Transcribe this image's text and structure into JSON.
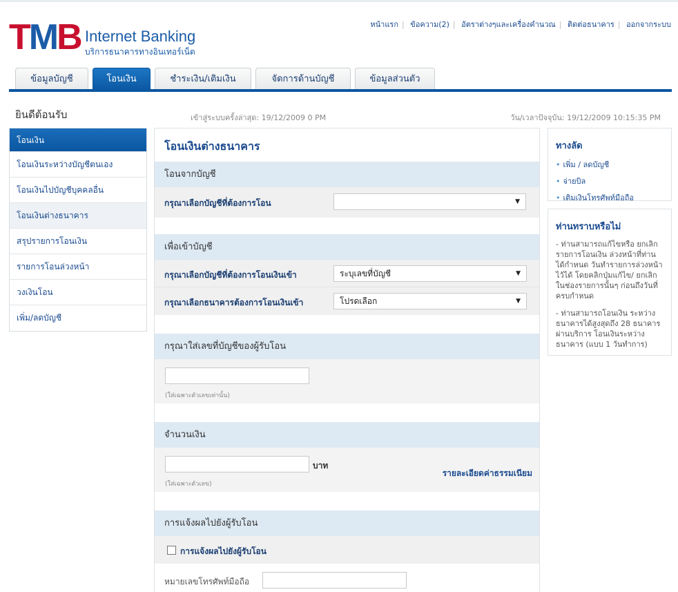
{
  "brand": {
    "logo_text": "TMB",
    "product": "Internet Banking",
    "subtitle": "บริการธนาคารทางอินเทอร์เน็ต"
  },
  "top_links": [
    "หน้าแรก",
    "ข้อความ(2)",
    "อัตราต่างๆและเครื่องคำนวณ",
    "ติดต่อธนาคาร",
    "ออกจากระบบ"
  ],
  "tabs": [
    "ข้อมูลบัญชี",
    "โอนเงิน",
    "ชำระเงิน/เติมเงิน",
    "จัดการด้านบัญชี",
    "ข้อมูลส่วนตัว"
  ],
  "active_tab": "โอนเงิน",
  "welcome": "ยินดีต้อนรับ",
  "last_login": "เข้าสู่ระบบครั้งล่าสุด: 19/12/2009 0        PM",
  "current_time": "วัน/เวลาปัจจุบัน: 19/12/2009 10:15:35 PM",
  "left_menu": {
    "header": "โอนเงิน",
    "items": [
      "โอนเงินระหว่างบัญชีตนเอง",
      "โอนเงินไปบัญชีบุคคลอื่น",
      "โอนเงินต่างธนาคาร",
      "สรุปรายการโอนเงิน",
      "รายการโอนล่วงหน้า",
      "วงเงินโอน",
      "เพิ่ม/ลดบัญชี"
    ],
    "selected": "โอนเงินต่างธนาคาร"
  },
  "main": {
    "title": "โอนเงินต่างธนาคาร",
    "from_section": "โอนจากบัญชี",
    "from_label": "กรุณาเลือกบัญชีที่ต้องการโอน",
    "from_value": "",
    "to_section": "เพื่อเข้าบัญชี",
    "to_account_label": "กรุณาเลือกบัญชีที่ต้องการโอนเงินเข้า",
    "to_account_value": "ระบุเลขที่บัญชี",
    "to_bank_label": "กรุณาเลือกธนาคารต้องการโอนเงินเข้า",
    "to_bank_value": "โปรดเลือก",
    "recipient_section": "กรุณาใส่เลขที่บัญชีของผู้รับโอน",
    "recipient_hint": "(ใส่เฉพาะตัวเลขเท่านั้น)",
    "amount_section": "จำนวนเงิน",
    "amount_unit": "บาท",
    "amount_hint": "(ใส่เฉพาะตัวเลข)",
    "fee_link": "รายละเอียดค่าธรรมเนียม",
    "notify_section": "การแจ้งผลไปยังผู้รับโอน",
    "notify_checkbox": "การแจ้งผลไปยังผู้รับโอน",
    "notify_checked": false,
    "mobile_label": "หมายเลขโทรศัพท์มือถือ"
  },
  "shortcuts": {
    "title": "ทางลัด",
    "items": [
      "เพิ่ม / ลดบัญชี",
      "จ่ายบิล",
      "เติมเงินโทรศัพท์มือถือ"
    ]
  },
  "did_you_know": {
    "title": "ท่านทราบหรือไม่",
    "p1": "- ท่านสามารถแก้ไขหรือ ยกเลิกรายการโอนเงิน ล่วงหน้าที่ท่านได้กำหนด วันทำรายการล่วงหน้าไว้ได้ โดยคลิกปุ่มแก้ไข/ ยกเลิก ในช่องรายการนั้นๆ ก่อนถึงวันที่ครบกำหนด",
    "p2": "- ท่านสามารถโอนเงิน ระหว่างธนาคารได้สูงสุดถึง 28 ธนาคาร ผ่านบริการ โอนเงินระหว่างธนาคาร (แบบ 1 วันทำการ)"
  },
  "colors": {
    "brand_red": "#c8102e",
    "brand_blue": "#0b56a1",
    "section_bg": "#dde9f3"
  }
}
